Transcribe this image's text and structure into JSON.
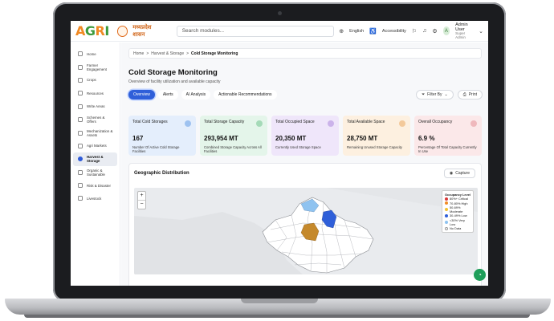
{
  "topbar": {
    "logo": {
      "a": "A",
      "g": "G",
      "r": "R",
      "i": "I"
    },
    "govt": "मध्यप्रदेश शासन",
    "search_placeholder": "Search modules...",
    "language": "English",
    "accessibility": "Accessibility",
    "user_name": "Admin User",
    "user_role": "Super Admin",
    "avatar_initial": "A"
  },
  "sidebar": {
    "items": [
      {
        "label": "Home"
      },
      {
        "label": "Farmer Engagement"
      },
      {
        "label": "Crops"
      },
      {
        "label": "Resources"
      },
      {
        "label": "Write Areas"
      },
      {
        "label": "Schemes & Offers"
      },
      {
        "label": "Mechanization & Assets"
      },
      {
        "label": "Agri Markets"
      },
      {
        "label": "Harvest & Storage"
      },
      {
        "label": "Organic & Sustainable"
      },
      {
        "label": "Risk & Disaster"
      },
      {
        "label": "Livestock"
      }
    ],
    "active_index": 8
  },
  "breadcrumb": {
    "home": "Home",
    "sep": ">",
    "section": "Harvest & Storage",
    "current": "Cold Storage Monitoring"
  },
  "page": {
    "title": "Cold Storage Monitoring",
    "subtitle": "Overview of facility utilization and available capacity"
  },
  "tabs": [
    "Overview",
    "Alerts",
    "AI Analysis",
    "Actionable Recommendations"
  ],
  "actions": {
    "filter": "Filter By",
    "print": "Print"
  },
  "cards": [
    {
      "title": "Total Cold Storages",
      "value": "167",
      "desc": "Number Of Active Cold Storage Facilities"
    },
    {
      "title": "Total Storage Capacity",
      "value": "293,954 MT",
      "desc": "Combined Storage Capacity Across All Facilities"
    },
    {
      "title": "Total Occupied Space",
      "value": "20,350 MT",
      "desc": "Currently Used Storage Space"
    },
    {
      "title": "Total Available Space",
      "value": "28,750 MT",
      "desc": "Remaining Unused Storage Capacity"
    },
    {
      "title": "Overall Occupancy",
      "value": "6.9 %",
      "desc": "Percentage Of Total Capacity Currently In Use"
    }
  ],
  "geo": {
    "title": "Geographic Distribution",
    "capture": "Capture",
    "zoom_in": "+",
    "zoom_out": "−",
    "legend": {
      "title": "Occupancy Level",
      "items": [
        {
          "label": "80%+ Critical",
          "color": "#d93636"
        },
        {
          "label": "70-80% High",
          "color": "#f08a24"
        },
        {
          "label": "50-69% Moderate",
          "color": "#f2c230"
        },
        {
          "label": "30-49% Low",
          "color": "#2f5fd9"
        },
        {
          "label": "<30% Very Low",
          "color": "#8fc3f0"
        },
        {
          "label": "No Data",
          "color": "#ffffff"
        }
      ]
    }
  },
  "chat_icon": "chat-icon"
}
